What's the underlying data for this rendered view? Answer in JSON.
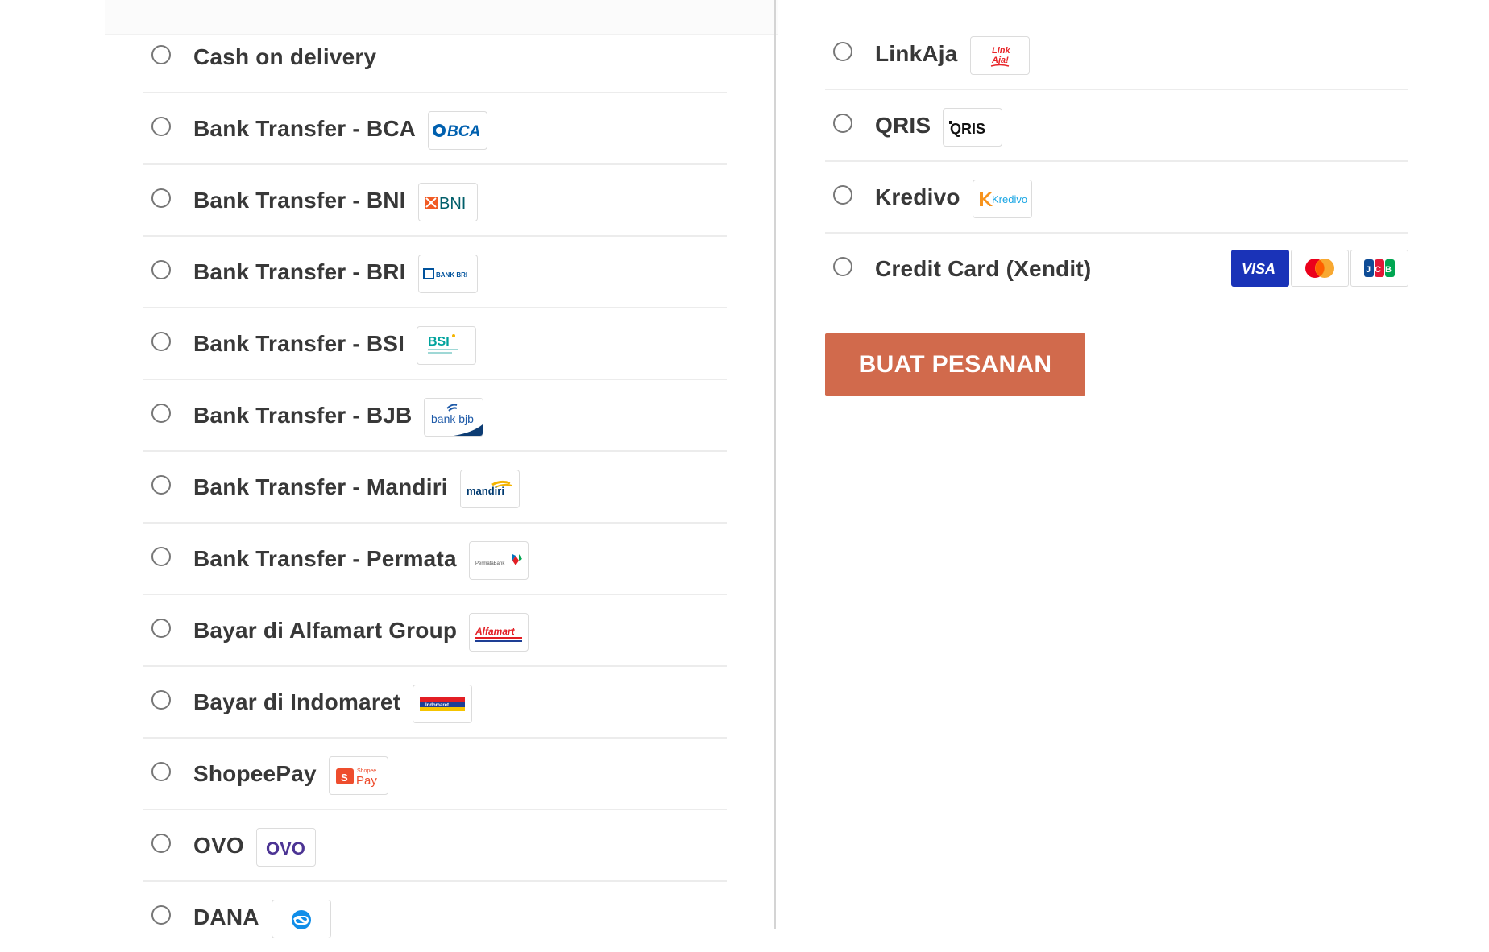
{
  "left_methods": [
    {
      "label": "Cash on delivery",
      "logo": ""
    },
    {
      "label": "Bank Transfer - BCA",
      "logo": "bca-logo"
    },
    {
      "label": "Bank Transfer - BNI",
      "logo": "bni-logo"
    },
    {
      "label": "Bank Transfer - BRI",
      "logo": "bri-logo"
    },
    {
      "label": "Bank Transfer - BSI",
      "logo": "bsi-logo"
    },
    {
      "label": "Bank Transfer - BJB",
      "logo": "bjb-logo"
    },
    {
      "label": "Bank Transfer - Mandiri",
      "logo": "mandiri-logo"
    },
    {
      "label": "Bank Transfer - Permata",
      "logo": "permata-logo"
    },
    {
      "label": "Bayar di Alfamart Group",
      "logo": "alfamart-logo"
    },
    {
      "label": "Bayar di Indomaret",
      "logo": "indomaret-logo"
    },
    {
      "label": "ShopeePay",
      "logo": "shopeepay-logo"
    },
    {
      "label": "OVO",
      "logo": "ovo-logo"
    },
    {
      "label": "DANA",
      "logo": "dana-logo"
    }
  ],
  "right_methods": [
    {
      "label": "LinkAja",
      "logo": "linkaja-logo"
    },
    {
      "label": "QRIS",
      "logo": "qris-logo"
    },
    {
      "label": "Kredivo",
      "logo": "kredivo-logo"
    },
    {
      "label": "Credit Card (Xendit)",
      "logo": "card-network-logos"
    }
  ],
  "logo_text": {
    "bca": "BCA",
    "bni": "BNI",
    "bri": "BANK BRI",
    "bsi": "BSI",
    "bjb": "bank bjb",
    "mandiri": "mandiri",
    "permata": "PermataBank",
    "alfamart": "Alfamart",
    "indomaret": "Indomaret",
    "shopeepay_top": "Shopee",
    "shopeepay_bottom": "Pay",
    "ovo": "OVO",
    "linkaja_top": "Link",
    "linkaja_bottom": "Aja!",
    "qris": "QRIS",
    "kredivo": "Kredivo",
    "visa": "VISA",
    "jcb": "JCB"
  },
  "order_button": {
    "label": "BUAT PESANAN"
  },
  "colors": {
    "button_bg": "#d16a4c",
    "visa_blue": "#1a33b8",
    "mastercard_red": "#eb001b",
    "mastercard_orange": "#f79e1b",
    "bca_blue": "#0060af",
    "bni_orange": "#f15a23",
    "bni_teal": "#005e6a",
    "ovo_purple": "#4c3494",
    "dana_blue": "#118ee9",
    "alfamart_red": "#e31e24",
    "kredivo_orange": "#f7931d",
    "kredivo_blue": "#1aa6e4",
    "linkaja_red": "#e82529"
  }
}
